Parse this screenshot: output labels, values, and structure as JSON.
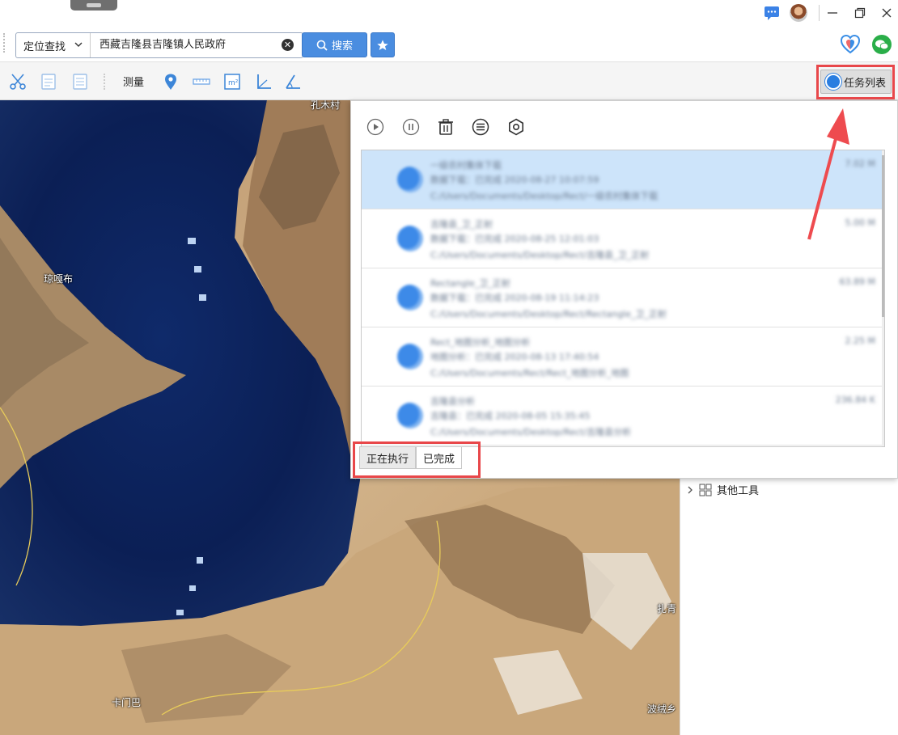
{
  "titlebar": {
    "icons": [
      "chat-icon",
      "avatar",
      "minimize-icon",
      "maximize-icon",
      "close-icon"
    ]
  },
  "search": {
    "mode": "定位查找",
    "query": "西藏吉隆县吉隆镇人民政府",
    "search_button": "搜索",
    "colors": {
      "accent": "#4a8de0"
    }
  },
  "toolbar": {
    "measure_label": "测量",
    "task_list_button": "任务列表",
    "tools": [
      "scissors-icon",
      "doc-icon",
      "list-doc-icon",
      "location-pin-icon",
      "ruler-icon",
      "area-icon",
      "angle-icon",
      "azimuth-icon"
    ]
  },
  "map": {
    "labels": {
      "top": "孔木村",
      "left": "琼嘎布",
      "bottom_left": "卡门巴",
      "right": "扎青",
      "bottom_right": "波绒乡"
    }
  },
  "task_panel": {
    "tools": [
      "play-icon",
      "pause-icon",
      "trash-icon",
      "list-icon",
      "settings-icon"
    ],
    "tabs": [
      "正在执行",
      "已完成"
    ],
    "rows": [
      {
        "title": "一级农村集体下载",
        "status": "数据下载：已完成 2020-08-27 10:07:59",
        "path": "C:/Users/Documents/Desktop/Rect/一级农村集体下载",
        "size": "7.02 M"
      },
      {
        "title": "吉隆县_卫_正射",
        "status": "数据下载：已完成 2020-08-25 12:01:03",
        "path": "C:/Users/Documents/Desktop/Rect/吉隆县_卫_正射",
        "size": "5.00 M"
      },
      {
        "title": "Rectangle_卫_正射",
        "status": "数据下载：已完成 2020-08-19 11:14:23",
        "path": "C:/Users/Documents/Desktop/Rect/Rectangle_卫_正射",
        "size": "63.89 M"
      },
      {
        "title": "Rect_地图分析_地图分析",
        "status": "地图分析：已完成 2020-08-13 17:40:54",
        "path": "C:/Users/Documents/Rect/Rect_地图分析_地图",
        "size": "2.25 M"
      },
      {
        "title": "吉隆县分析",
        "status": "吉隆县：已完成 2020-08-05 15:35:45",
        "path": "C:/Users/Documents/Desktop/Rect/吉隆县分析",
        "size": "236.84 K"
      }
    ]
  },
  "right_panel": {
    "tree_item": "其他工具"
  }
}
